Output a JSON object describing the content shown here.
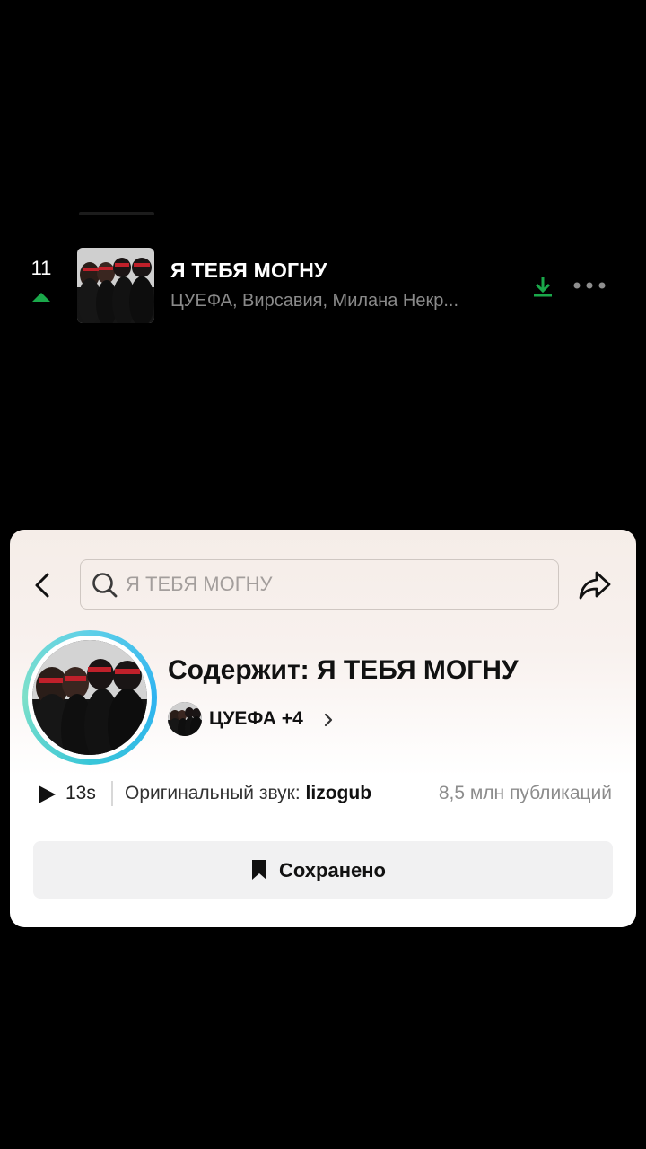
{
  "chart_row": {
    "rank": "11",
    "rank_trend": "up",
    "title": "Я ТЕБЯ МОГНУ",
    "artists": "ЦУЕФА, Вирсавия, Милана Некр...",
    "download_icon": "download-icon",
    "more_icon": "more-icon"
  },
  "sound_card": {
    "search": {
      "placeholder": "Я ТЕБЯ МОГНУ"
    },
    "contains_title": "Содержит: Я ТЕБЯ МОГНУ",
    "artist_label": "ЦУЕФА +4",
    "duration": "13s",
    "original_sound_prefix": "Оригинальный звук: ",
    "original_sound_author": "lizogub",
    "post_count": "8,5 млн публикаций",
    "saved_label": "Сохранено"
  },
  "colors": {
    "trend_up": "#1aa84a",
    "download": "#1aa84a",
    "ring_accent": "#2fb3f0",
    "background": "#000000",
    "card_tint": "#f5ede8"
  }
}
